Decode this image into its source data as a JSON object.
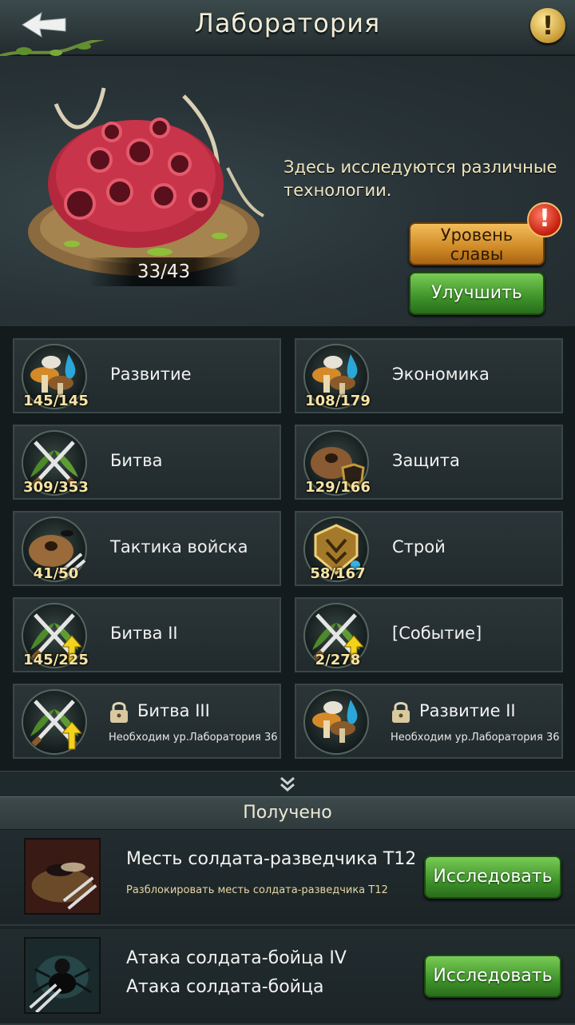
{
  "header": {
    "title": "Лаборатория"
  },
  "hero": {
    "counter": "33/43",
    "description": "Здесь исследуются различные технологии.",
    "glory_line1": "Уровень",
    "glory_line2": "славы",
    "upgrade_label": "Улучшить"
  },
  "categories": [
    {
      "label": "Развитие",
      "count": "145/145",
      "icon": "mushroom-drop-icon"
    },
    {
      "label": "Экономика",
      "count": "108/179",
      "icon": "mushroom-drop-icon"
    },
    {
      "label": "Битва",
      "count": "309/353",
      "icon": "crossed-swords-icon"
    },
    {
      "label": "Защита",
      "count": "129/166",
      "icon": "anthill-shield-icon"
    },
    {
      "label": "Тактика войска",
      "count": "41/50",
      "icon": "anthill-ant-swords-icon"
    },
    {
      "label": "Строй",
      "count": "58/167",
      "icon": "formation-shield-icon"
    },
    {
      "label": "Битва II",
      "count": "145/225",
      "icon": "crossed-swords-arrow-icon"
    },
    {
      "label": "[Событие]",
      "count": "2/278",
      "icon": "crossed-swords-arrow-icon"
    },
    {
      "label": "Битва III",
      "requirement": "Необходим ур.Лаборатория 36",
      "icon": "crossed-swords-arrow-icon",
      "locked": true
    },
    {
      "label": "Развитие II",
      "requirement": "Необходим ур.Лаборатория 36",
      "icon": "mushroom-drop-icon",
      "locked": true
    }
  ],
  "received": {
    "header": "Получено",
    "items": [
      {
        "title": "Месть солдата-разведчика T12",
        "subtitle": "Разблокировать месть солдата-разведчика T12",
        "button": "Исследовать",
        "icon": "scout-ant-icon"
      },
      {
        "title": "Атака солдата-бойца IV",
        "subtitle": "Атака солдата-бойца",
        "button": "Исследовать",
        "icon": "fighter-ant-icon"
      }
    ]
  },
  "colors": {
    "button_green": "#3e932a",
    "button_orange": "#cf8a26",
    "count_text": "#f7e4a3",
    "background": "#1b2326"
  }
}
